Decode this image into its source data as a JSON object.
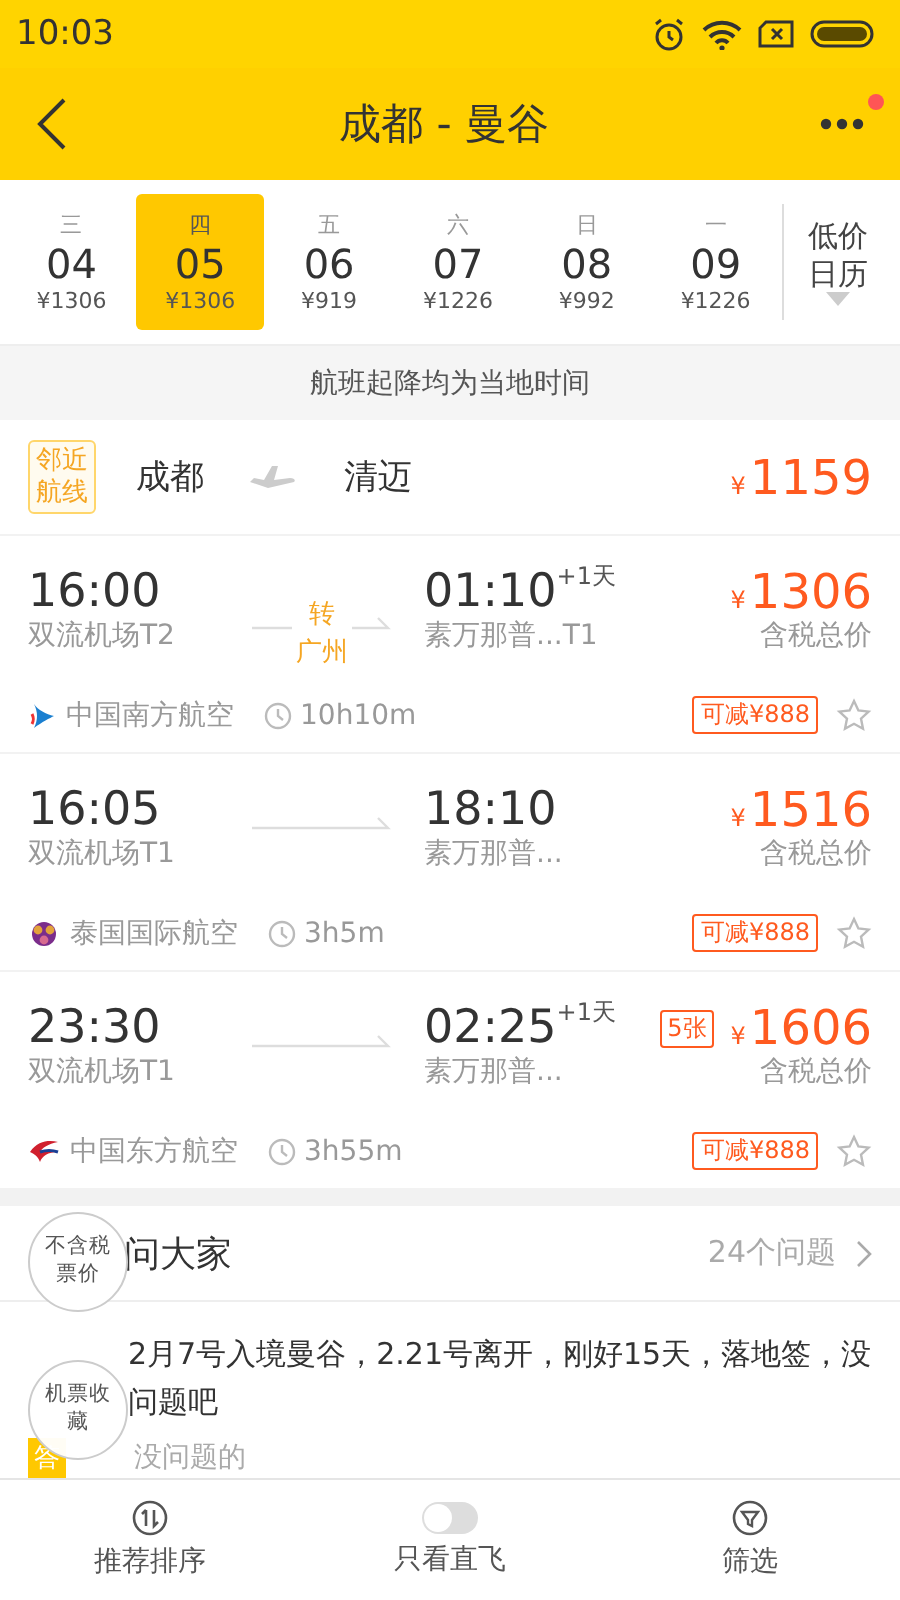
{
  "status_bar": {
    "time": "10:03"
  },
  "header": {
    "title": "成都 - 曼谷",
    "notification": true
  },
  "dates": [
    {
      "weekday": "三",
      "day": "04",
      "price": "¥1306",
      "selected": false
    },
    {
      "weekday": "四",
      "day": "05",
      "price": "¥1306",
      "selected": true
    },
    {
      "weekday": "五",
      "day": "06",
      "price": "¥919",
      "selected": false
    },
    {
      "weekday": "六",
      "day": "07",
      "price": "¥1226",
      "selected": false
    },
    {
      "weekday": "日",
      "day": "08",
      "price": "¥992",
      "selected": false
    },
    {
      "weekday": "一",
      "day": "09",
      "price": "¥1226",
      "selected": false
    }
  ],
  "calendar_button": "低价日历",
  "notice": "航班起降均为当地时间",
  "nearby_route": {
    "badge": "邻近航线",
    "from": "成都",
    "to": "清迈",
    "currency": "¥",
    "price": "1159"
  },
  "flights": [
    {
      "dep_time": "16:00",
      "dep_airport": "双流机场T2",
      "transfer": {
        "label": "转",
        "city": "广州"
      },
      "arr_time": "01:10",
      "next_day": "+1天",
      "arr_airport": "素万那普...T1",
      "currency": "¥",
      "price": "1306",
      "price_note": "含税总价",
      "airline": {
        "name": "中国南方航空",
        "kind": "southern"
      },
      "duration": "10h10m",
      "discount": "可减¥888",
      "favorited": false
    },
    {
      "dep_time": "16:05",
      "dep_airport": "双流机场T1",
      "arr_time": "18:10",
      "arr_airport": "素万那普...",
      "currency": "¥",
      "price": "1516",
      "price_note": "含税总价",
      "airline": {
        "name": "泰国国际航空",
        "kind": "thai"
      },
      "duration": "3h5m",
      "discount": "可减¥888",
      "favorited": false
    },
    {
      "dep_time": "23:30",
      "dep_airport": "双流机场T1",
      "arr_time": "02:25",
      "next_day": "+1天",
      "arr_airport": "素万那普...",
      "tickets_left": "5张",
      "currency": "¥",
      "price": "1606",
      "price_note": "含税总价",
      "airline": {
        "name": "中国东方航空",
        "kind": "eastern"
      },
      "duration": "3h55m",
      "discount": "可减¥888",
      "favorited": false
    }
  ],
  "qa": {
    "title": "问大家",
    "count": "24个问题",
    "question": "2月7号入境曼谷，2.21号离开，刚好15天，落地签，没问题吧",
    "answer_badge": "答",
    "answer": "没问题的"
  },
  "floating_buttons": [
    "不含税票价",
    "机票收藏"
  ],
  "bottom_bar": [
    {
      "kind": "sort",
      "label": "推荐排序"
    },
    {
      "kind": "toggle",
      "label": "只看直飞",
      "on": false
    },
    {
      "kind": "filter",
      "label": "筛选"
    }
  ]
}
